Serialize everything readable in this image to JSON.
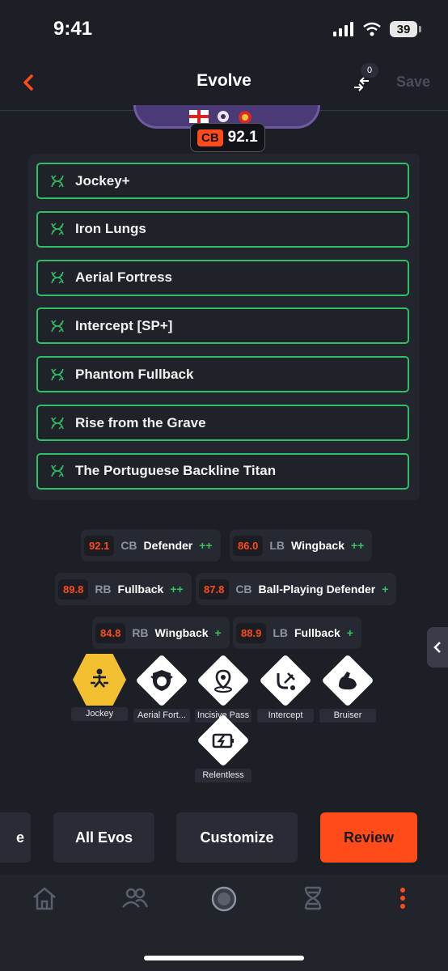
{
  "status": {
    "time": "9:41",
    "battery": "39"
  },
  "header": {
    "title": "Evolve",
    "back_icon": "chevron-left-icon",
    "compare_count": "0",
    "save_label": "Save"
  },
  "card": {
    "position": "CB",
    "rating": "92.1"
  },
  "playstyles_list": [
    {
      "label": "Jockey+"
    },
    {
      "label": "Iron Lungs"
    },
    {
      "label": "Aerial Fortress"
    },
    {
      "label": "Intercept [SP+]"
    },
    {
      "label": "Phantom Fullback"
    },
    {
      "label": "Rise from the Grave"
    },
    {
      "label": "The Portuguese Backline Titan"
    }
  ],
  "roles": [
    {
      "rating": "92.1",
      "pos": "CB",
      "name": "Defender",
      "plus": "++"
    },
    {
      "rating": "86.0",
      "pos": "LB",
      "name": "Wingback",
      "plus": "++"
    },
    {
      "rating": "89.8",
      "pos": "RB",
      "name": "Fullback",
      "plus": "++"
    },
    {
      "rating": "87.8",
      "pos": "CB",
      "name": "Ball-Playing Defender",
      "plus": "+"
    },
    {
      "rating": "84.8",
      "pos": "RB",
      "name": "Wingback",
      "plus": "+"
    },
    {
      "rating": "88.9",
      "pos": "LB",
      "name": "Fullback",
      "plus": "+"
    }
  ],
  "playstyles": [
    {
      "label": "Jockey",
      "icon": "jockey-icon",
      "plus": true
    },
    {
      "label": "Aerial Fort...",
      "icon": "aerial-fortress-icon"
    },
    {
      "label": "Incisive Pass",
      "icon": "incisive-pass-icon"
    },
    {
      "label": "Intercept",
      "icon": "intercept-icon"
    },
    {
      "label": "Bruiser",
      "icon": "bruiser-icon"
    },
    {
      "label": "Relentless",
      "icon": "relentless-icon"
    }
  ],
  "buttons": {
    "partial": "e",
    "all_evos": "All Evos",
    "customize": "Customize",
    "review": "Review"
  },
  "tabs": [
    "home-icon",
    "friends-icon",
    "club-icon",
    "evolution-icon",
    "more-icon"
  ],
  "colors": {
    "accent": "#ff4a1a",
    "green": "#2fbf66",
    "background": "#1d1f27",
    "gold": "#f2c030"
  }
}
